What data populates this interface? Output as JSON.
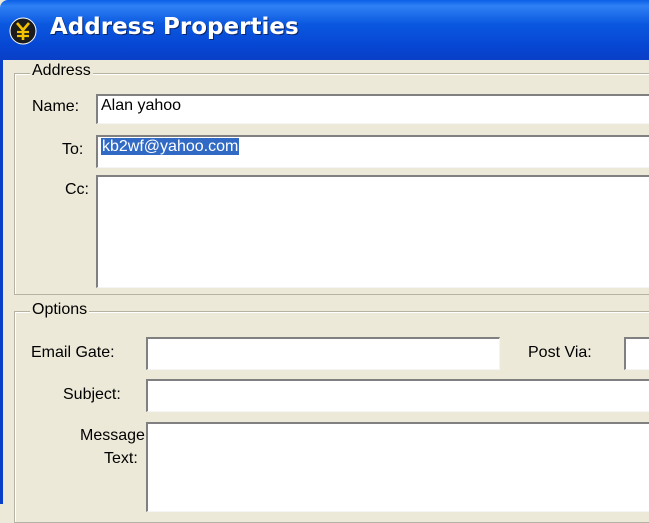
{
  "window": {
    "title": "Address Properties",
    "icon": "yen-coin-icon"
  },
  "address": {
    "legend": "Address",
    "name_label": "Name:",
    "name_value": "Alan yahoo",
    "to_label": "To:",
    "to_value": "kb2wf@yahoo.com",
    "cc_label": "Cc:",
    "cc_value": ""
  },
  "options": {
    "legend": "Options",
    "email_gate_label": "Email Gate:",
    "email_gate_value": "",
    "post_via_label": "Post Via:",
    "post_via_value": "",
    "subject_label": "Subject:",
    "subject_value": "",
    "message_label_1": "Message",
    "message_label_2": "Text:",
    "message_value": ""
  },
  "colors": {
    "title_bar": "#0a5fe6",
    "selection": "#316ac5",
    "dialog_bg": "#ece9d8"
  }
}
